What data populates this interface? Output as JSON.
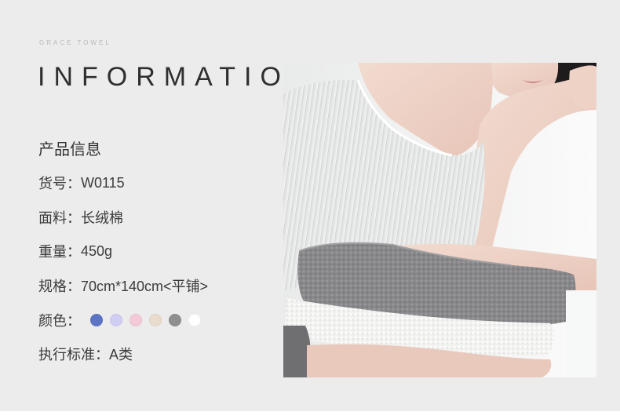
{
  "header": {
    "brand": "GRACE TOWEL",
    "title": "INFORMATION"
  },
  "info": {
    "heading": "产品信息",
    "sku": {
      "label": "货号：",
      "value": "W0115"
    },
    "material": {
      "label": "面料：",
      "value": "长绒棉"
    },
    "weight": {
      "label": "重量：",
      "value": "450g"
    },
    "size": {
      "label": "规格：",
      "value": "70cm*140cm<平铺>"
    },
    "colors": {
      "label": "颜色：",
      "swatches": [
        "#5b74c4",
        "#cfcdf3",
        "#f4c9d9",
        "#e9dccd",
        "#8f8f8f",
        "#ffffff"
      ]
    },
    "standard": {
      "label": "执行标准：",
      "value": "A类"
    }
  },
  "colors": {
    "background": "#ececed",
    "text": "#3b3b3b"
  }
}
